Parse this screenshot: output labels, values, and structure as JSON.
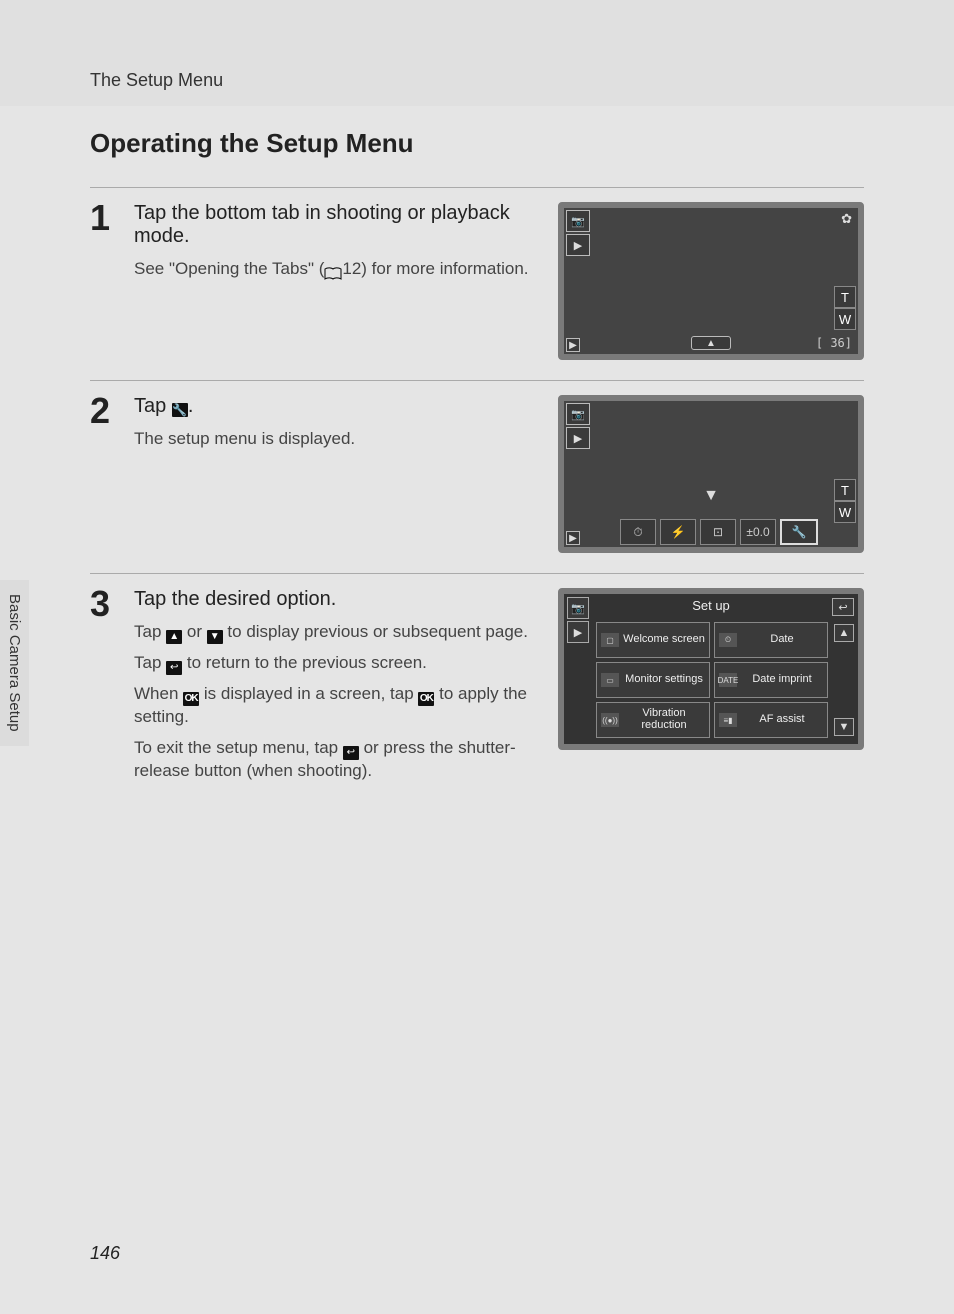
{
  "header": {
    "section": "The Setup Menu"
  },
  "title": "Operating the Setup Menu",
  "side_tab": "Basic Camera Setup",
  "page_number": "146",
  "steps": [
    {
      "num": "1",
      "head": "Tap the bottom tab in shooting or playback mode.",
      "sub_pre": "See \"Opening the Tabs\" (",
      "sub_ref": "12) for more information.",
      "lcd": {
        "tabs": [
          "📷",
          "▶"
        ],
        "zoom_t": "T",
        "zoom_w": "W",
        "star": "✿",
        "counter": "[   36]",
        "uparrow": "▲",
        "leftarrow": "▶"
      }
    },
    {
      "num": "2",
      "head_pre": "Tap ",
      "head_post": ".",
      "sub": "The setup menu is displayed.",
      "lcd": {
        "tabs": [
          "📷",
          "▶"
        ],
        "zoom_t": "T",
        "zoom_w": "W",
        "downarrow": "▼",
        "leftarrow": "▶",
        "iconrow": [
          "⏱",
          "⚡",
          "⊡",
          "±0.0",
          "🔧"
        ]
      }
    },
    {
      "num": "3",
      "head": "Tap the desired option.",
      "subs": [
        {
          "pre": "Tap ",
          "mid": " or ",
          "post": " to display previous or subsequent page."
        },
        {
          "pre": "Tap ",
          "post": " to return to the previous screen."
        },
        {
          "pre": "When ",
          "mid": " is displayed in a screen, tap ",
          "post": " to apply the setting."
        },
        {
          "pre": "To exit the setup menu, tap ",
          "post": " or press the shutter-release button (when shooting)."
        }
      ],
      "lcd": {
        "title": "Set up",
        "side_tabs": [
          "📷",
          "▶"
        ],
        "back": "↩",
        "up": "▲",
        "down": "▼",
        "options": [
          {
            "icon": "▢",
            "label": "Welcome screen"
          },
          {
            "icon": "⏲",
            "label": "Date"
          },
          {
            "icon": "▭",
            "label": "Monitor settings"
          },
          {
            "icon": "DATE",
            "label": "Date imprint"
          },
          {
            "icon": "((●))",
            "label": "Vibration reduction"
          },
          {
            "icon": "≡▮",
            "label": "AF assist"
          }
        ]
      }
    }
  ],
  "glyphs": {
    "wrench": "🔧",
    "up": "▲",
    "down": "▼",
    "back": "↩",
    "ok": "OK"
  }
}
